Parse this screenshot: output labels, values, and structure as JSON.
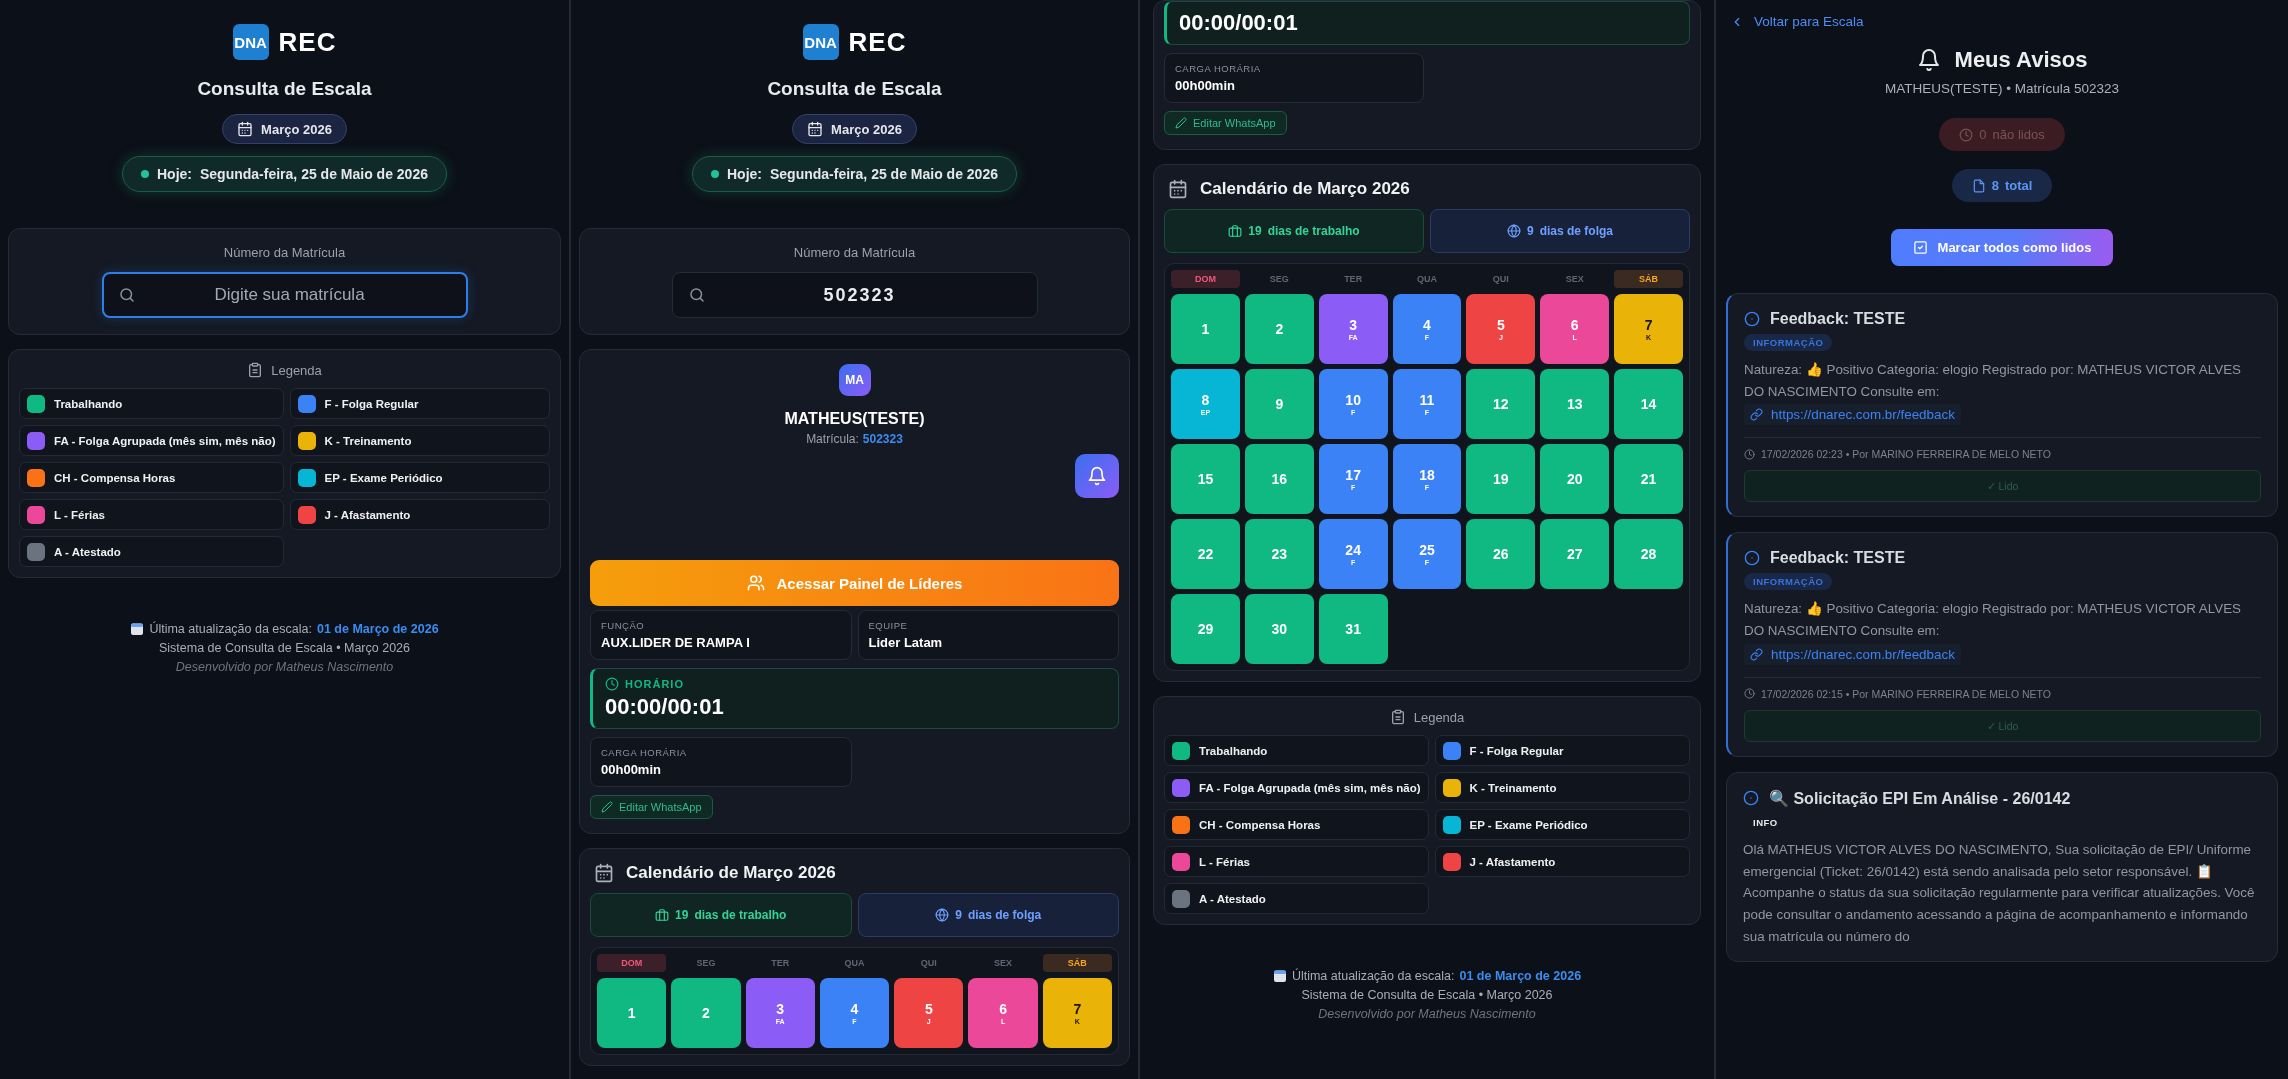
{
  "panels": [
    {
      "kind": "scale",
      "header": {
        "logo": "DNA",
        "app_name": "REC",
        "title": "Consulta de Escala",
        "month": "Março 2026",
        "today_label": "Hoje:",
        "today": "Segunda-feira, 25 de Maio de 2026"
      },
      "search": {
        "label": "Número da Matrícula",
        "placeholder": "Digite sua matrícula",
        "focused": true
      },
      "legend": {
        "title": "Legenda",
        "items": [
          {
            "label": "Trabalhando",
            "color": "#10b981"
          },
          {
            "label": "F - Folga Regular",
            "color": "#3b82f6"
          },
          {
            "label": "FA - Folga Agrupada (mês sim, mês não)",
            "color": "#8b5cf6"
          },
          {
            "label": "K - Treinamento",
            "color": "#eab308"
          },
          {
            "label": "CH - Compensa Horas",
            "color": "#f97316"
          },
          {
            "label": "EP - Exame Periódico",
            "color": "#06b6d4"
          },
          {
            "label": "L - Férias",
            "color": "#ec4899"
          },
          {
            "label": "J - Afastamento",
            "color": "#ef4444"
          },
          {
            "label": "A - Atestado",
            "color": "#6b7280"
          }
        ]
      },
      "footer": {
        "update_label": "Última atualização da escala:",
        "update_date": "01 de Março de 2026",
        "system": "Sistema de Consulta de Escala • Março 2026",
        "credit": "Desenvolvido por Matheus Nascimento"
      }
    },
    {
      "kind": "scale",
      "header": {
        "logo": "DNA",
        "app_name": "REC",
        "title": "Consulta de Escala",
        "month": "Março 2026",
        "today_label": "Hoje:",
        "today": "Segunda-feira, 25 de Maio de 2026"
      },
      "search": {
        "label": "Número da Matrícula",
        "value": "502323",
        "focused": false
      },
      "profile": {
        "initials": "MA",
        "name": "MATHEUS(TESTE)",
        "matricula_label": "Matrícula:",
        "matricula": "502323",
        "leaders_button": "Acessar Painel de Líderes",
        "info": [
          {
            "label": "FUNÇÃO",
            "value": "AUX.LIDER DE RAMPA I"
          },
          {
            "label": "EQUIPE",
            "value": "Lider Latam"
          }
        ],
        "horario": {
          "label": "HORÁRIO",
          "value": "00:00/00:01"
        },
        "carga": {
          "label": "CARGA HORÁRIA",
          "value": "00h00min"
        },
        "whatsapp_button": "Editar WhatsApp"
      },
      "calendar": {
        "title": "Calendário de Março 2026",
        "work": {
          "count": "19",
          "label": "dias de trabalho"
        },
        "off": {
          "count": "9",
          "label": "dias de folga"
        },
        "weekdays": [
          {
            "label": "DOM",
            "kind": "sunday"
          },
          {
            "label": "SEG",
            "kind": "weekday"
          },
          {
            "label": "TER",
            "kind": "weekday"
          },
          {
            "label": "QUA",
            "kind": "weekday"
          },
          {
            "label": "QUI",
            "kind": "weekday"
          },
          {
            "label": "SEX",
            "kind": "weekday"
          },
          {
            "label": "SÁB",
            "kind": "saturday"
          }
        ],
        "days": [
          {
            "day": "1",
            "color": "#10b981"
          },
          {
            "day": "2",
            "color": "#10b981"
          },
          {
            "day": "3",
            "code": "FA",
            "color": "#8b5cf6"
          },
          {
            "day": "4",
            "code": "F",
            "color": "#3b82f6"
          },
          {
            "day": "5",
            "code": "J",
            "color": "#ef4444"
          },
          {
            "day": "6",
            "code": "L",
            "color": "#ec4899"
          },
          {
            "day": "7",
            "code": "K",
            "color": "#eab308"
          }
        ]
      }
    },
    {
      "kind": "scale",
      "profile": {
        "horario": {
          "value": "00:00/00:01"
        },
        "carga": {
          "label": "CARGA HORÁRIA",
          "value": "00h00min"
        },
        "whatsapp_button": "Editar WhatsApp"
      },
      "calendar": {
        "title": "Calendário de Março 2026",
        "work": {
          "count": "19",
          "label": "dias de trabalho"
        },
        "off": {
          "count": "9",
          "label": "dias de folga"
        },
        "weekdays": [
          {
            "label": "DOM",
            "kind": "sunday"
          },
          {
            "label": "SEG",
            "kind": "weekday"
          },
          {
            "label": "TER",
            "kind": "weekday"
          },
          {
            "label": "QUA",
            "kind": "weekday"
          },
          {
            "label": "QUI",
            "kind": "weekday"
          },
          {
            "label": "SEX",
            "kind": "weekday"
          },
          {
            "label": "SÁB",
            "kind": "saturday"
          }
        ],
        "days": [
          {
            "day": "1",
            "color": "#10b981"
          },
          {
            "day": "2",
            "color": "#10b981"
          },
          {
            "day": "3",
            "code": "FA",
            "color": "#8b5cf6"
          },
          {
            "day": "4",
            "code": "F",
            "color": "#3b82f6"
          },
          {
            "day": "5",
            "code": "J",
            "color": "#ef4444"
          },
          {
            "day": "6",
            "code": "L",
            "color": "#ec4899"
          },
          {
            "day": "7",
            "code": "K",
            "color": "#eab308"
          },
          {
            "day": "8",
            "code": "EP",
            "color": "#06b6d4"
          },
          {
            "day": "9",
            "color": "#10b981"
          },
          {
            "day": "10",
            "code": "F",
            "color": "#3b82f6"
          },
          {
            "day": "11",
            "code": "F",
            "color": "#3b82f6"
          },
          {
            "day": "12",
            "color": "#10b981"
          },
          {
            "day": "13",
            "color": "#10b981"
          },
          {
            "day": "14",
            "color": "#10b981"
          },
          {
            "day": "15",
            "color": "#10b981"
          },
          {
            "day": "16",
            "color": "#10b981"
          },
          {
            "day": "17",
            "code": "F",
            "color": "#3b82f6"
          },
          {
            "day": "18",
            "code": "F",
            "color": "#3b82f6"
          },
          {
            "day": "19",
            "color": "#10b981"
          },
          {
            "day": "20",
            "color": "#10b981"
          },
          {
            "day": "21",
            "color": "#10b981"
          },
          {
            "day": "22",
            "color": "#10b981"
          },
          {
            "day": "23",
            "color": "#10b981"
          },
          {
            "day": "24",
            "code": "F",
            "color": "#3b82f6"
          },
          {
            "day": "25",
            "code": "F",
            "color": "#3b82f6"
          },
          {
            "day": "26",
            "color": "#10b981"
          },
          {
            "day": "27",
            "color": "#10b981"
          },
          {
            "day": "28",
            "color": "#10b981"
          },
          {
            "day": "29",
            "color": "#10b981"
          },
          {
            "day": "30",
            "color": "#10b981"
          },
          {
            "day": "31",
            "color": "#10b981"
          }
        ]
      },
      "legend": {
        "title": "Legenda",
        "items": [
          {
            "label": "Trabalhando",
            "color": "#10b981"
          },
          {
            "label": "F - Folga Regular",
            "color": "#3b82f6"
          },
          {
            "label": "FA - Folga Agrupada (mês sim, mês não)",
            "color": "#8b5cf6"
          },
          {
            "label": "K - Treinamento",
            "color": "#eab308"
          },
          {
            "label": "CH - Compensa Horas",
            "color": "#f97316"
          },
          {
            "label": "EP - Exame Periódico",
            "color": "#06b6d4"
          },
          {
            "label": "L - Férias",
            "color": "#ec4899"
          },
          {
            "label": "J - Afastamento",
            "color": "#ef4444"
          },
          {
            "label": "A - Atestado",
            "color": "#6b7280"
          }
        ]
      },
      "footer": {
        "update_label": "Última atualização da escala:",
        "update_date": "01 de Março de 2026",
        "system": "Sistema de Consulta de Escala • Março 2026",
        "credit": "Desenvolvido por Matheus Nascimento"
      }
    },
    {
      "kind": "notices",
      "back_link": "Voltar para Escala",
      "title": "Meus Avisos",
      "subtitle": "MATHEUS(TESTE) • Matrícula 502323",
      "unread": {
        "count": "0",
        "label": "não lidos"
      },
      "total": {
        "count": "8",
        "label": "total"
      },
      "mark_all": "Marcar todos como lidos",
      "items": [
        {
          "kind": "feedback",
          "title": "Feedback: TESTE",
          "tag": "INFORMAÇÃO",
          "body": "Natureza: 👍 Positivo Categoria: elogio Registrado por: MATHEUS VICTOR ALVES DO NASCIMENTO Consulte em:",
          "link": "https://dnarec.com.br/feedback",
          "meta": "17/02/2026 02:23 • Por MARINO FERREIRA DE MELO NETO",
          "read_button": "✓ Lido"
        },
        {
          "kind": "feedback",
          "title": "Feedback: TESTE",
          "tag": "INFORMAÇÃO",
          "body": "Natureza: 👍 Positivo Categoria: elogio Registrado por: MATHEUS VICTOR ALVES DO NASCIMENTO Consulte em:",
          "link": "https://dnarec.com.br/feedback",
          "meta": "17/02/2026 02:15 • Por MARINO FERREIRA DE MELO NETO",
          "read_button": "✓ Lido"
        },
        {
          "kind": "request",
          "title": "🔍 Solicitação EPI Em Análise - 26/0142",
          "tag": "INFO",
          "body": "Olá MATHEUS VICTOR ALVES DO NASCIMENTO, Sua solicitação de EPI/ Uniforme emergencial (Ticket: 26/0142) está sendo analisada pelo setor responsável. 📋 Acompanhe o status da sua solicitação regularmente para verificar atualizações. Você pode consultar o andamento acessando a página de acompanhamento e informando sua matrícula ou número do"
        }
      ]
    }
  ]
}
